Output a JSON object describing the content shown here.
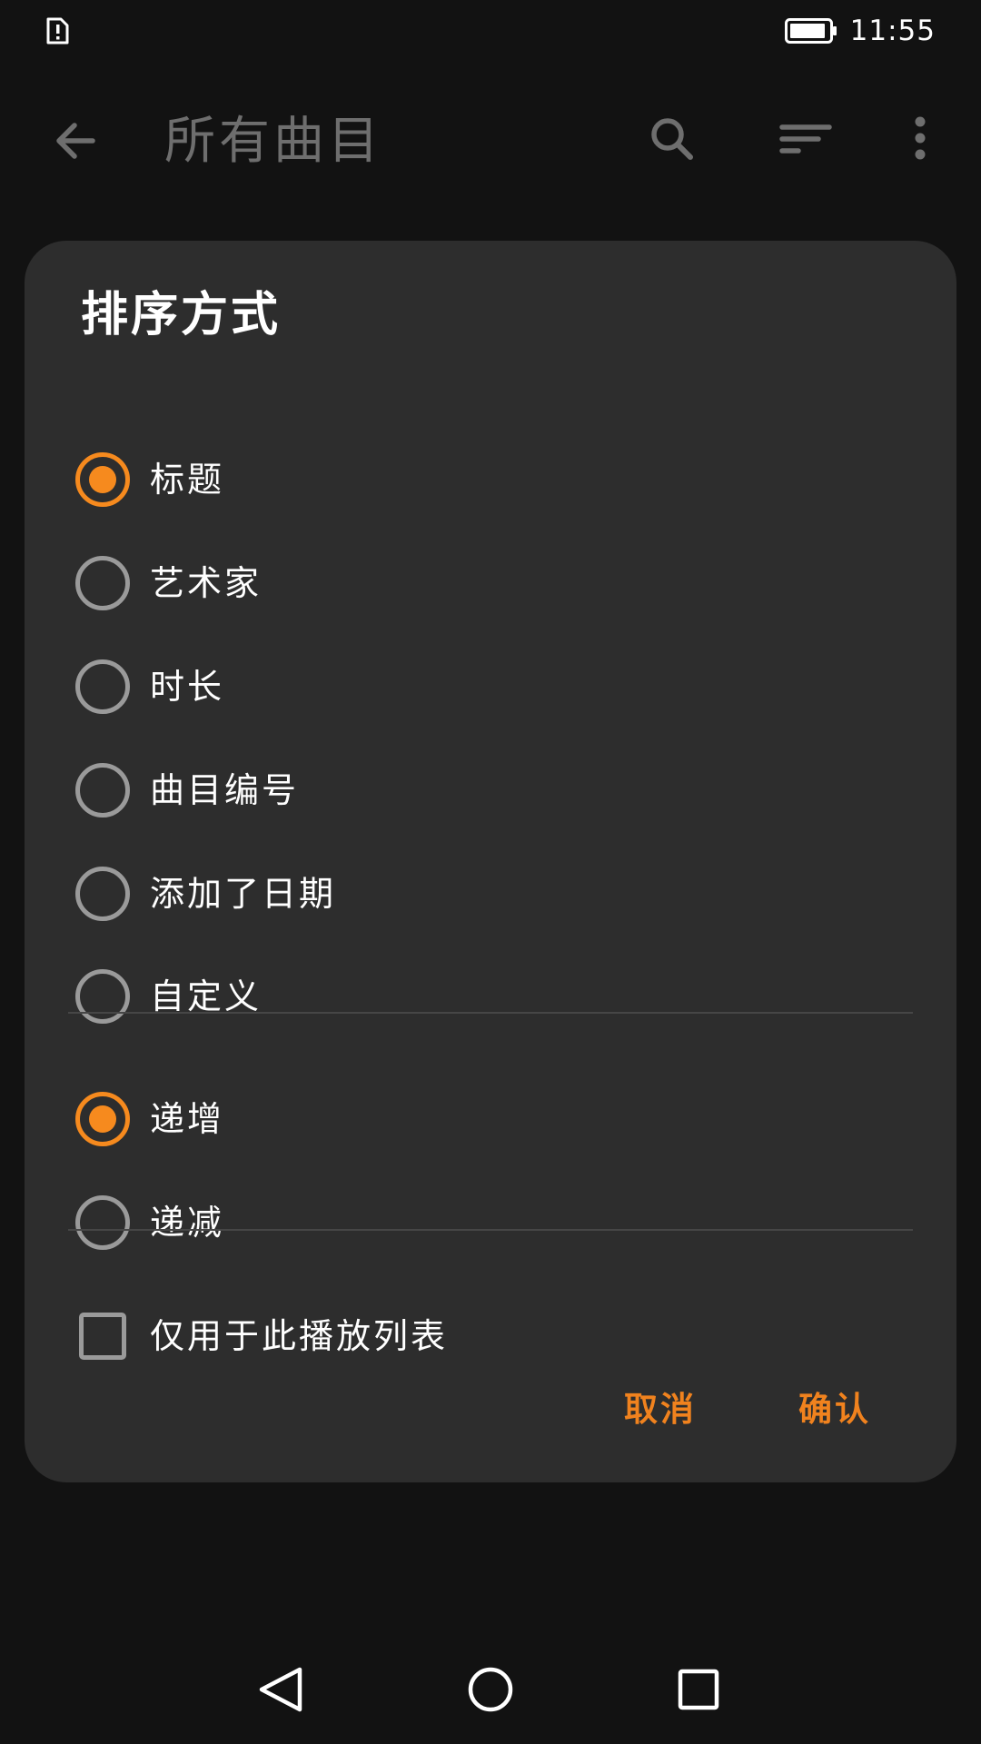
{
  "status_bar": {
    "time": "11:55",
    "icons": [
      "sim-alert-icon",
      "battery-icon"
    ]
  },
  "app_bar": {
    "title": "所有曲目",
    "icons": [
      "back-arrow-icon",
      "search-icon",
      "sort-icon",
      "more-vertical-icon"
    ]
  },
  "dialog": {
    "title": "排序方式",
    "sort_by": [
      {
        "label": "标题",
        "checked": true
      },
      {
        "label": "艺术家",
        "checked": false
      },
      {
        "label": "时长",
        "checked": false
      },
      {
        "label": "曲目编号",
        "checked": false
      },
      {
        "label": "添加了日期",
        "checked": false
      },
      {
        "label": "自定义",
        "checked": false
      }
    ],
    "order": [
      {
        "label": "递增",
        "checked": true
      },
      {
        "label": "递减",
        "checked": false
      }
    ],
    "playlist_only": {
      "label": "仅用于此播放列表",
      "checked": false
    },
    "cancel_label": "取消",
    "confirm_label": "确认"
  },
  "nav_bar": {
    "icons": [
      "nav-back-icon",
      "nav-home-icon",
      "nav-recent-icon"
    ]
  },
  "colors": {
    "accent": "#f68a1e",
    "dialog_bg": "#2d2d2d",
    "screen_bg": "#121212"
  }
}
